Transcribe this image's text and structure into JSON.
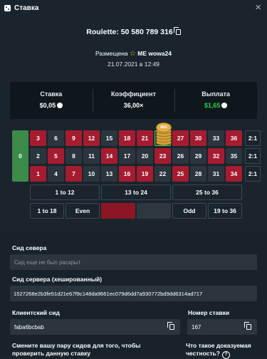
{
  "header": {
    "title": "Ставка",
    "close": "×"
  },
  "game": {
    "title": "Roulette: 50 580 789 316"
  },
  "placed": {
    "prefix": "Размещена",
    "user": "ME wowa24",
    "date": "21.07.2021 в 12:49"
  },
  "stats": [
    {
      "label": "Ставка",
      "value": "$0,05"
    },
    {
      "label": "Коэффициент",
      "value": "36,00×"
    },
    {
      "label": "Выплата",
      "value": "$1,65"
    }
  ],
  "board": {
    "zero": "0",
    "rows": [
      [
        3,
        6,
        9,
        12,
        15,
        18,
        21,
        24,
        27,
        30,
        33,
        36
      ],
      [
        2,
        5,
        8,
        11,
        14,
        17,
        20,
        23,
        26,
        29,
        32,
        35
      ],
      [
        1,
        4,
        7,
        10,
        13,
        16,
        19,
        22,
        25,
        28,
        31,
        34
      ]
    ],
    "red_numbers": [
      1,
      3,
      5,
      7,
      9,
      12,
      14,
      16,
      18,
      19,
      21,
      23,
      25,
      27,
      30,
      32,
      34,
      36
    ],
    "selected_number": 24,
    "columns": [
      "2:1",
      "2:1",
      "2:1"
    ],
    "dozens": [
      "1 to 12",
      "13 to 24",
      "25 to 36"
    ],
    "outside": [
      "1 to 18",
      "Even",
      "",
      "",
      "Odd",
      "19 to 36"
    ],
    "chip_label": "45K",
    "colors": {
      "red": "#a51c30",
      "black": "#2a353e",
      "zero": "#3c8b4a",
      "selected": "#3cd94e"
    }
  },
  "fields": {
    "server_seed": {
      "label": "Сид севера",
      "placeholder": "Сид еще не был раскрыт"
    },
    "server_seed_hashed": {
      "label": "Сид сервера (хешированный)",
      "value": "1527268e2b3fe51d21e67f9c148da9661ec079d6dd7a930772bd9dd6314ad717"
    },
    "client_seed": {
      "label": "Клиентский сид",
      "value": "faba6bcbab"
    },
    "bet_number": {
      "label": "Номер ставки",
      "value": "167"
    }
  },
  "notes": {
    "change_seeds": "Смените вашу пару сидов для того, чтобы проверить данную ставку",
    "provably_fair": "Что такое доказуемая честность?"
  }
}
